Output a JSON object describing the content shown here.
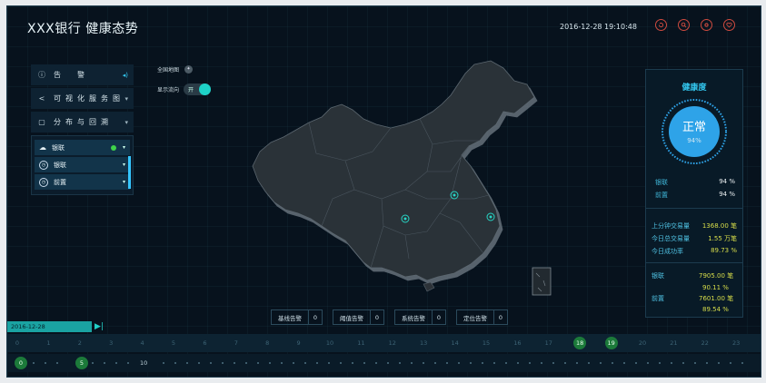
{
  "header": {
    "title": "XXX银行 健康态势",
    "datetime": "2016-12-28 19:10:48",
    "icons": [
      "refresh-icon",
      "search-icon",
      "settings-icon",
      "favorite-icon"
    ],
    "accent_color": "#cf4b3f"
  },
  "left_menu": {
    "items": [
      {
        "label": "告　警",
        "icon": "alert-icon",
        "right": "speaker-icon"
      },
      {
        "label": "可视化服务图",
        "icon": "share-icon",
        "right": "chevron-down-icon"
      },
      {
        "label": "分布与回溯",
        "icon": "document-icon",
        "right": "chevron-down-icon"
      }
    ],
    "sub_items": [
      {
        "label": "银联",
        "icon": "cloud-icon"
      },
      {
        "label": "银联",
        "icon": "clock-icon"
      },
      {
        "label": "前置",
        "icon": "clock-icon"
      }
    ]
  },
  "map_controls": {
    "national_map_label": "全国地图",
    "show_direction_label": "显示流向",
    "switch_label": "开"
  },
  "health": {
    "title": "健康度",
    "status": "正常",
    "percent": "94%",
    "percent_value": 94,
    "rows": [
      {
        "name": "银联",
        "value": "94 %"
      },
      {
        "name": "前置",
        "value": "94 %"
      }
    ]
  },
  "transactions": [
    {
      "name": "上分钟交易量",
      "value": "1368.00 笔"
    },
    {
      "name": "今日总交易量",
      "value": "1.55 万笔"
    },
    {
      "name": "今日成功率",
      "value": "89.73 %"
    }
  ],
  "breakdown": [
    {
      "name": "银联",
      "count": "7905.00 笔",
      "rate": "90.11 %"
    },
    {
      "name": "前置",
      "count": "7601.00 笔",
      "rate": "89.54 %"
    }
  ],
  "alerts": [
    {
      "label": "基线告警",
      "count": "0"
    },
    {
      "label": "阈值告警",
      "count": "0"
    },
    {
      "label": "系统告警",
      "count": "0"
    },
    {
      "label": "定位告警",
      "count": "0"
    }
  ],
  "timeline": {
    "date": "2016-12-28",
    "hours": [
      "0",
      "1",
      "2",
      "3",
      "4",
      "5",
      "6",
      "7",
      "8",
      "9",
      "10",
      "11",
      "12",
      "13",
      "14",
      "15",
      "16",
      "17",
      "18",
      "19",
      "20",
      "21",
      "22",
      "23"
    ],
    "selected_hours": [
      "18",
      "19"
    ],
    "minute_start": "0",
    "minute_mark": "5",
    "minute_end": "10"
  },
  "colors": {
    "background": "#07121d",
    "map_fill": "#2c3238",
    "health_ring": "#2ea3e8",
    "highlight_text": "#d8de4a",
    "accent_cyan": "#1ed2c8"
  }
}
